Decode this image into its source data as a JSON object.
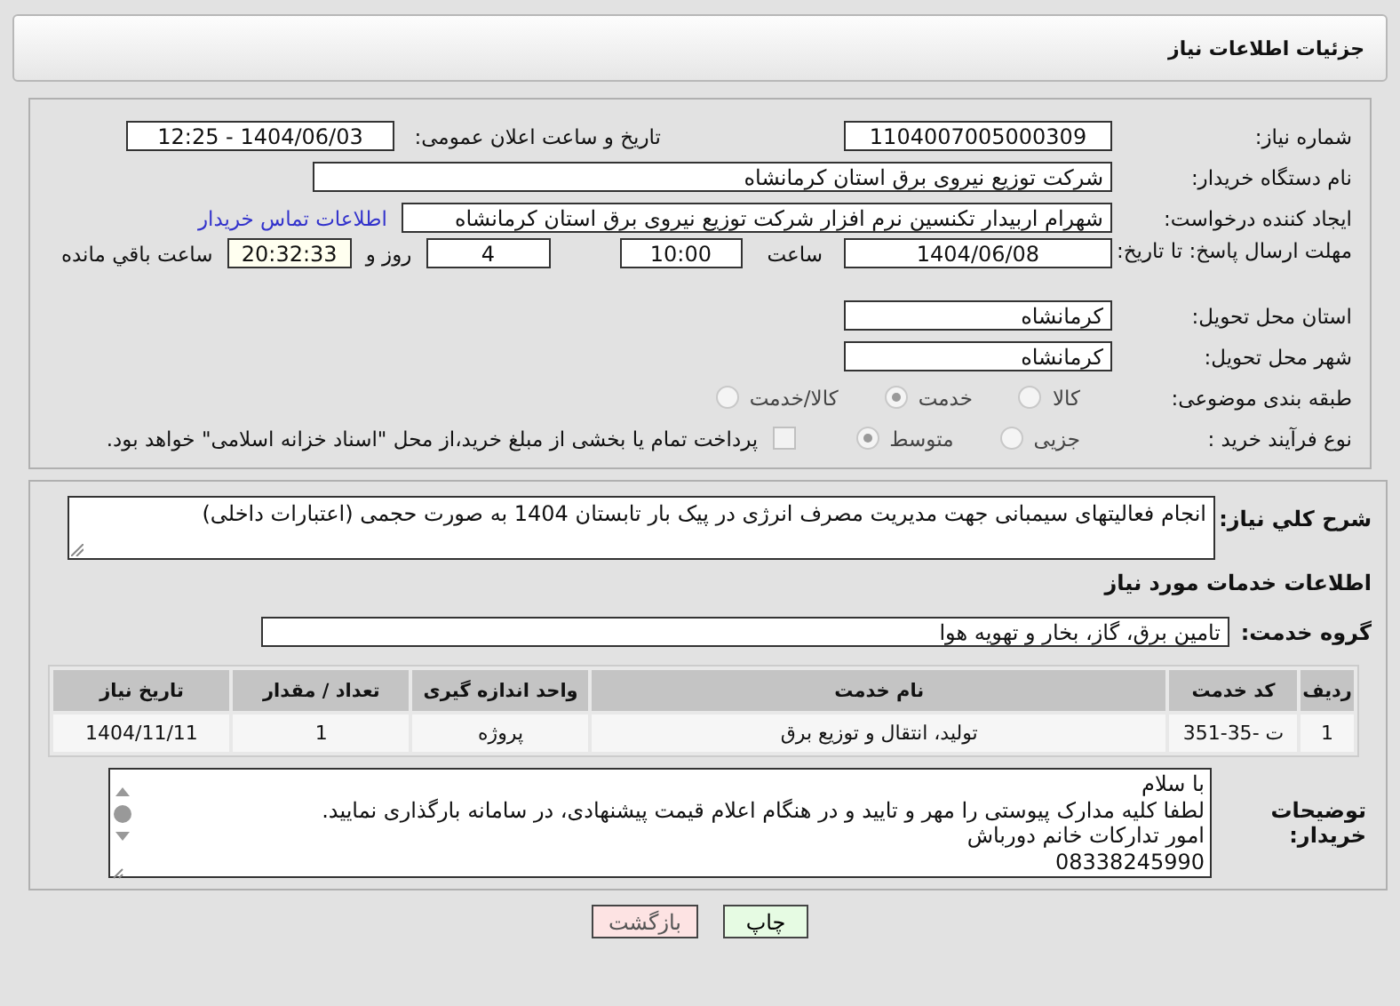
{
  "header": {
    "title": "جزئیات اطلاعات نیاز"
  },
  "details": {
    "need_number": {
      "label": "شماره نیاز:",
      "value": "1104007005000309"
    },
    "announce_date": {
      "label": "تاریخ و ساعت اعلان عمومی:",
      "value": "1404/06/03 - 12:25"
    },
    "buyer_org": {
      "label": "نام دستگاه خریدار:",
      "value": "شرکت توزیع نیروی برق استان کرمانشاه"
    },
    "creator": {
      "label": "ایجاد کننده درخواست:",
      "value": "شهرام اربیدار تکنسین نرم افزار شرکت توزیع نیروی برق استان کرمانشاه",
      "link": "اطلاعات تماس خریدار"
    },
    "deadline": {
      "label": "مهلت ارسال پاسخ: تا تاریخ:",
      "date": "1404/06/08",
      "time_label": "ساعت",
      "time": "10:00",
      "days": "4",
      "days_label": "روز و",
      "remaining": "20:32:33",
      "remaining_label": "ساعت باقي مانده"
    },
    "province": {
      "label": "استان محل تحویل:",
      "value": "کرمانشاه"
    },
    "city": {
      "label": "شهر محل تحویل:",
      "value": "کرمانشاه"
    },
    "category": {
      "label": "طبقه بندی موضوعی:",
      "options": [
        {
          "label": "کالا",
          "selected": false
        },
        {
          "label": "خدمت",
          "selected": true
        },
        {
          "label": "کالا/خدمت",
          "selected": false
        }
      ]
    },
    "process": {
      "label": "نوع فرآیند خرید :",
      "options": [
        {
          "label": "جزیی",
          "selected": false
        },
        {
          "label": "متوسط",
          "selected": true
        }
      ],
      "payment": {
        "checked": false,
        "text": "پرداخت تمام یا بخشی از مبلغ خرید،از محل \"اسناد خزانه اسلامی\" خواهد بود."
      }
    }
  },
  "summary": {
    "label": "شرح کلي نياز:",
    "value": "انجام فعالیتهای سیمبانی جهت مدیریت مصرف انرژی در پیک بار تابستان 1404 به صورت حجمی (اعتبارات داخلی)"
  },
  "services_heading": "اطلاعات خدمات مورد نیاز",
  "service_group": {
    "label": "گروه خدمت:",
    "value": "تامین برق، گاز، بخار و تهویه هوا"
  },
  "table": {
    "columns": [
      "ردیف",
      "کد خدمت",
      "نام خدمت",
      "واحد اندازه گیری",
      "تعداد / مقدار",
      "تاریخ نیاز"
    ],
    "rows": [
      [
        "1",
        "ت -35-351",
        "تولید، انتقال و توزیع برق",
        "پروژه",
        "1",
        "1404/11/11"
      ]
    ]
  },
  "buyer_notes": {
    "label": "توضیحات خریدار:",
    "lines": [
      "با سلام",
      "لطفا کلیه مدارک پیوستی را مهر و تایید و در هنگام اعلام قیمت پیشنهادی، در سامانه بارگذاری نمایید.",
      "امور تدارکات خانم دورباش",
      "08338245990"
    ]
  },
  "buttons": [
    {
      "label": "چاپ",
      "kind": "print"
    },
    {
      "label": "بازگشت",
      "kind": "back"
    }
  ]
}
